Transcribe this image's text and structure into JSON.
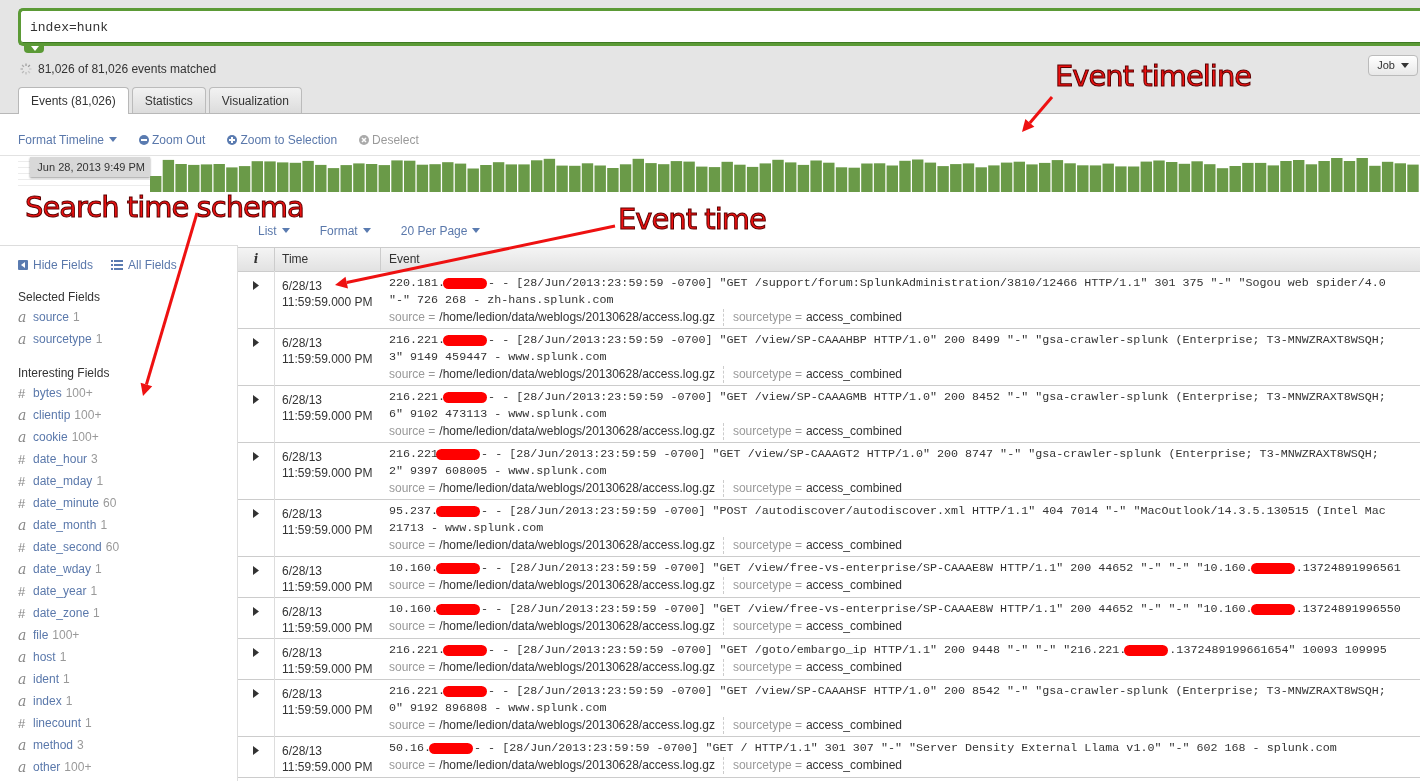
{
  "search": {
    "value": "index=hunk"
  },
  "status": {
    "text": "81,026 of 81,026 events matched"
  },
  "job_button": {
    "label": "Job"
  },
  "tabs": [
    {
      "label": "Events (81,026)",
      "selected": true
    },
    {
      "label": "Statistics",
      "selected": false
    },
    {
      "label": "Visualization",
      "selected": false
    }
  ],
  "timeline": {
    "controls": [
      {
        "label": "Format Timeline",
        "kind": "menu",
        "disabled": false
      },
      {
        "label": "Zoom Out",
        "kind": "zoom-out",
        "disabled": false
      },
      {
        "label": "Zoom to Selection",
        "kind": "zoom-in",
        "disabled": false
      },
      {
        "label": "Deselect",
        "kind": "deselect",
        "disabled": true
      }
    ],
    "tooltip": "Jun 28, 2013 9:49 PM"
  },
  "sidebar": {
    "actions": [
      {
        "label": "Hide Fields",
        "kind": "hide"
      },
      {
        "label": "All Fields",
        "kind": "list"
      }
    ],
    "sections": [
      {
        "title": "Selected Fields",
        "fields": [
          {
            "type": "a",
            "name": "source",
            "count": "1"
          },
          {
            "type": "a",
            "name": "sourcetype",
            "count": "1"
          }
        ]
      },
      {
        "title": "Interesting Fields",
        "fields": [
          {
            "type": "#",
            "name": "bytes",
            "count": "100+"
          },
          {
            "type": "a",
            "name": "clientip",
            "count": "100+"
          },
          {
            "type": "a",
            "name": "cookie",
            "count": "100+"
          },
          {
            "type": "#",
            "name": "date_hour",
            "count": "3"
          },
          {
            "type": "#",
            "name": "date_mday",
            "count": "1"
          },
          {
            "type": "#",
            "name": "date_minute",
            "count": "60"
          },
          {
            "type": "a",
            "name": "date_month",
            "count": "1"
          },
          {
            "type": "#",
            "name": "date_second",
            "count": "60"
          },
          {
            "type": "a",
            "name": "date_wday",
            "count": "1"
          },
          {
            "type": "#",
            "name": "date_year",
            "count": "1"
          },
          {
            "type": "#",
            "name": "date_zone",
            "count": "1"
          },
          {
            "type": "a",
            "name": "file",
            "count": "100+"
          },
          {
            "type": "a",
            "name": "host",
            "count": "1"
          },
          {
            "type": "a",
            "name": "ident",
            "count": "1"
          },
          {
            "type": "a",
            "name": "index",
            "count": "1"
          },
          {
            "type": "#",
            "name": "linecount",
            "count": "1"
          },
          {
            "type": "a",
            "name": "method",
            "count": "3"
          },
          {
            "type": "a",
            "name": "other",
            "count": "100+"
          }
        ]
      }
    ]
  },
  "results_toolbar": [
    {
      "label": "List"
    },
    {
      "label": "Format"
    },
    {
      "label": "20 Per Page"
    }
  ],
  "table": {
    "columns": [
      "i",
      "Time",
      "Event"
    ],
    "rows": [
      {
        "date": "6/28/13",
        "time": "11:59:59.000 PM",
        "lines": [
          [
            {
              "kind": "text",
              "text": "220.181."
            },
            {
              "kind": "redaction"
            },
            {
              "kind": "text",
              "text": "- - [28/Jun/2013:23:59:59 -0700] \"GET /support/forum:SplunkAdministration/3810/12466 HTTP/1.1\" 301 375 \"-\" \"Sogou web spider/4.0"
            }
          ],
          [
            {
              "kind": "text",
              "text": "\"-\" 726 268 - zh-hans.splunk.com"
            }
          ]
        ],
        "fields": [
          {
            "label": "source =",
            "value": "/home/ledion/data/weblogs/20130628/access.log.gz"
          },
          {
            "label": "sourcetype =",
            "value": "access_combined"
          }
        ]
      },
      {
        "date": "6/28/13",
        "time": "11:59:59.000 PM",
        "lines": [
          [
            {
              "kind": "text",
              "text": "216.221."
            },
            {
              "kind": "redaction"
            },
            {
              "kind": "text",
              "text": "- - [28/Jun/2013:23:59:59 -0700] \"GET /view/SP-CAAAHBP HTTP/1.0\" 200 8499 \"-\" \"gsa-crawler-splunk (Enterprise; T3-MNWZRAXT8WSQH;"
            }
          ],
          [
            {
              "kind": "text",
              "text": "3\" 9149 459447 - www.splunk.com"
            }
          ]
        ],
        "fields": [
          {
            "label": "source =",
            "value": "/home/ledion/data/weblogs/20130628/access.log.gz"
          },
          {
            "label": "sourcetype =",
            "value": "access_combined"
          }
        ]
      },
      {
        "date": "6/28/13",
        "time": "11:59:59.000 PM",
        "lines": [
          [
            {
              "kind": "text",
              "text": "216.221."
            },
            {
              "kind": "redaction"
            },
            {
              "kind": "text",
              "text": "- - [28/Jun/2013:23:59:59 -0700] \"GET /view/SP-CAAAGMB HTTP/1.0\" 200 8452 \"-\" \"gsa-crawler-splunk (Enterprise; T3-MNWZRAXT8WSQH;"
            }
          ],
          [
            {
              "kind": "text",
              "text": "6\" 9102 473113 - www.splunk.com"
            }
          ]
        ],
        "fields": [
          {
            "label": "source =",
            "value": "/home/ledion/data/weblogs/20130628/access.log.gz"
          },
          {
            "label": "sourcetype =",
            "value": "access_combined"
          }
        ]
      },
      {
        "date": "6/28/13",
        "time": "11:59:59.000 PM",
        "lines": [
          [
            {
              "kind": "text",
              "text": "216.221"
            },
            {
              "kind": "redaction"
            },
            {
              "kind": "text",
              "text": "- - [28/Jun/2013:23:59:59 -0700] \"GET /view/SP-CAAAGT2 HTTP/1.0\" 200 8747 \"-\" \"gsa-crawler-splunk (Enterprise; T3-MNWZRAXT8WSQH;"
            }
          ],
          [
            {
              "kind": "text",
              "text": "2\" 9397 608005 - www.splunk.com"
            }
          ]
        ],
        "fields": [
          {
            "label": "source =",
            "value": "/home/ledion/data/weblogs/20130628/access.log.gz"
          },
          {
            "label": "sourcetype =",
            "value": "access_combined"
          }
        ]
      },
      {
        "date": "6/28/13",
        "time": "11:59:59.000 PM",
        "lines": [
          [
            {
              "kind": "text",
              "text": "95.237."
            },
            {
              "kind": "redaction"
            },
            {
              "kind": "text",
              "text": "- - [28/Jun/2013:23:59:59 -0700] \"POST /autodiscover/autodiscover.xml HTTP/1.1\" 404 7014 \"-\" \"MacOutlook/14.3.5.130515 (Intel Mac"
            }
          ],
          [
            {
              "kind": "text",
              "text": "21713 - www.splunk.com"
            }
          ]
        ],
        "fields": [
          {
            "label": "source =",
            "value": "/home/ledion/data/weblogs/20130628/access.log.gz"
          },
          {
            "label": "sourcetype =",
            "value": "access_combined"
          }
        ]
      },
      {
        "date": "6/28/13",
        "time": "11:59:59.000 PM",
        "lines": [
          [
            {
              "kind": "text",
              "text": "10.160."
            },
            {
              "kind": "redaction"
            },
            {
              "kind": "text",
              "text": "- - [28/Jun/2013:23:59:59 -0700] \"GET /view/free-vs-enterprise/SP-CAAAE8W HTTP/1.1\" 200 44652 \"-\" \"-\" \"10.160."
            },
            {
              "kind": "redaction"
            },
            {
              "kind": "text",
              "text": ".13724891996561"
            }
          ]
        ],
        "fields": [
          {
            "label": "source =",
            "value": "/home/ledion/data/weblogs/20130628/access.log.gz"
          },
          {
            "label": "sourcetype =",
            "value": "access_combined"
          }
        ]
      },
      {
        "date": "6/28/13",
        "time": "11:59:59.000 PM",
        "lines": [
          [
            {
              "kind": "text",
              "text": "10.160."
            },
            {
              "kind": "redaction"
            },
            {
              "kind": "text",
              "text": "- - [28/Jun/2013:23:59:59 -0700] \"GET /view/free-vs-enterprise/SP-CAAAE8W HTTP/1.1\" 200 44652 \"-\" \"-\" \"10.160."
            },
            {
              "kind": "redaction"
            },
            {
              "kind": "text",
              "text": ".13724891996550"
            }
          ]
        ],
        "fields": [
          {
            "label": "source =",
            "value": "/home/ledion/data/weblogs/20130628/access.log.gz"
          },
          {
            "label": "sourcetype =",
            "value": "access_combined"
          }
        ]
      },
      {
        "date": "6/28/13",
        "time": "11:59:59.000 PM",
        "lines": [
          [
            {
              "kind": "text",
              "text": "216.221."
            },
            {
              "kind": "redaction"
            },
            {
              "kind": "text",
              "text": "- - [28/Jun/2013:23:59:59 -0700] \"GET /goto/embargo_ip HTTP/1.1\" 200 9448 \"-\" \"-\" \"216.221."
            },
            {
              "kind": "redaction"
            },
            {
              "kind": "text",
              "text": ".1372489199661654\" 10093 109995"
            }
          ]
        ],
        "fields": [
          {
            "label": "source =",
            "value": "/home/ledion/data/weblogs/20130628/access.log.gz"
          },
          {
            "label": "sourcetype =",
            "value": "access_combined"
          }
        ]
      },
      {
        "date": "6/28/13",
        "time": "11:59:59.000 PM",
        "lines": [
          [
            {
              "kind": "text",
              "text": "216.221."
            },
            {
              "kind": "redaction"
            },
            {
              "kind": "text",
              "text": "- - [28/Jun/2013:23:59:59 -0700] \"GET /view/SP-CAAAHSF HTTP/1.0\" 200 8542 \"-\" \"gsa-crawler-splunk (Enterprise; T3-MNWZRAXT8WSQH;"
            }
          ],
          [
            {
              "kind": "text",
              "text": "0\" 9192 896808 - www.splunk.com"
            }
          ]
        ],
        "fields": [
          {
            "label": "source =",
            "value": "/home/ledion/data/weblogs/20130628/access.log.gz"
          },
          {
            "label": "sourcetype =",
            "value": "access_combined"
          }
        ]
      },
      {
        "date": "6/28/13",
        "time": "11:59:59.000 PM",
        "lines": [
          [
            {
              "kind": "text",
              "text": "50.16."
            },
            {
              "kind": "redaction"
            },
            {
              "kind": "text",
              "text": "- - [28/Jun/2013:23:59:59 -0700] \"GET / HTTP/1.1\" 301 307 \"-\" \"Server Density External Llama v1.0\" \"-\" 602 168 - splunk.com"
            }
          ]
        ],
        "fields": [
          {
            "label": "source =",
            "value": "/home/ledion/data/weblogs/20130628/access.log.gz"
          },
          {
            "label": "sourcetype =",
            "value": "access_combined"
          }
        ]
      }
    ]
  },
  "annotations": [
    {
      "text": "Event timeline"
    },
    {
      "text": "Search time schema"
    },
    {
      "text": "Event time"
    }
  ]
}
